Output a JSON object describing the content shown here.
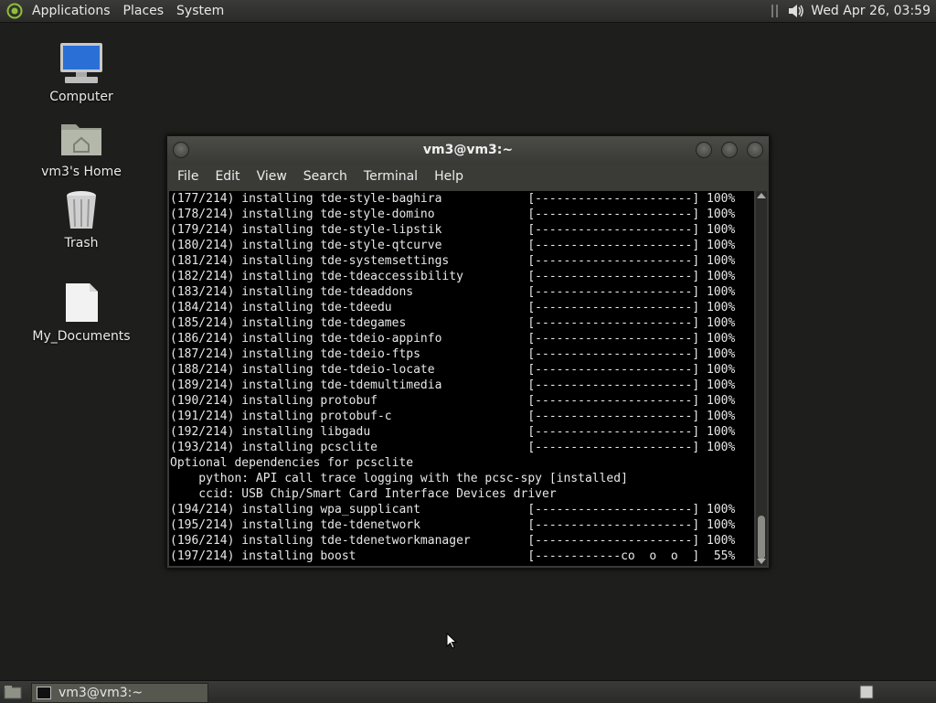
{
  "top_panel": {
    "menus": [
      "Applications",
      "Places",
      "System"
    ],
    "clock": "Wed Apr 26, 03:59"
  },
  "desktop": {
    "icons": [
      {
        "label": "Computer",
        "icon": "computer-icon"
      },
      {
        "label": "vm3's Home",
        "icon": "home-folder-icon"
      },
      {
        "label": "Trash",
        "icon": "trash-icon"
      },
      {
        "label": "My_Documents",
        "icon": "document-icon"
      }
    ]
  },
  "terminal": {
    "title": "vm3@vm3:~",
    "menu": [
      "File",
      "Edit",
      "View",
      "Search",
      "Terminal",
      "Help"
    ],
    "lines": [
      "(177/214) installing tde-style-baghira            [----------------------] 100%",
      "(178/214) installing tde-style-domino             [----------------------] 100%",
      "(179/214) installing tde-style-lipstik            [----------------------] 100%",
      "(180/214) installing tde-style-qtcurve            [----------------------] 100%",
      "(181/214) installing tde-systemsettings           [----------------------] 100%",
      "(182/214) installing tde-tdeaccessibility         [----------------------] 100%",
      "(183/214) installing tde-tdeaddons                [----------------------] 100%",
      "(184/214) installing tde-tdeedu                   [----------------------] 100%",
      "(185/214) installing tde-tdegames                 [----------------------] 100%",
      "(186/214) installing tde-tdeio-appinfo            [----------------------] 100%",
      "(187/214) installing tde-tdeio-ftps               [----------------------] 100%",
      "(188/214) installing tde-tdeio-locate             [----------------------] 100%",
      "(189/214) installing tde-tdemultimedia            [----------------------] 100%",
      "(190/214) installing protobuf                     [----------------------] 100%",
      "(191/214) installing protobuf-c                   [----------------------] 100%",
      "(192/214) installing libgadu                      [----------------------] 100%",
      "(193/214) installing pcsclite                     [----------------------] 100%",
      "Optional dependencies for pcsclite",
      "    python: API call trace logging with the pcsc-spy [installed]",
      "    ccid: USB Chip/Smart Card Interface Devices driver",
      "(194/214) installing wpa_supplicant               [----------------------] 100%",
      "(195/214) installing tde-tdenetwork               [----------------------] 100%",
      "(196/214) installing tde-tdenetworkmanager        [----------------------] 100%",
      "(197/214) installing boost                        [------------co  o  o  ]  55%"
    ]
  },
  "taskbar": {
    "task_label": "vm3@vm3:~"
  }
}
